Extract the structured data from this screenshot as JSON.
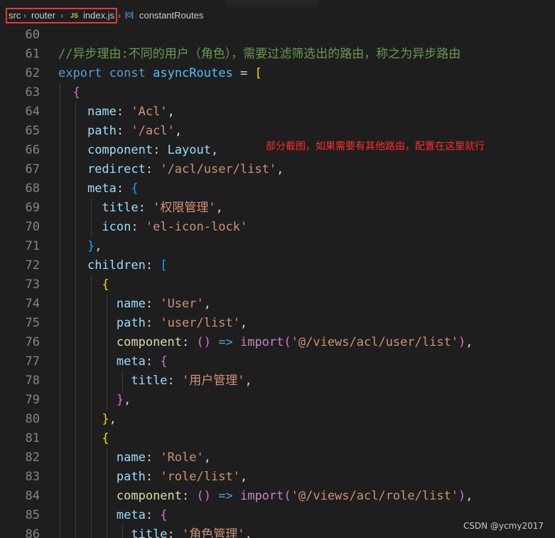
{
  "breadcrumb": {
    "segments": [
      "src",
      "router",
      "index.js",
      "constantRoutes"
    ],
    "file_icon": "JS",
    "symbol_icon": "[⊙]",
    "highlight_color": "#e53935"
  },
  "editor": {
    "line_numbers": [
      "60",
      "61",
      "62",
      "63",
      "64",
      "65",
      "66",
      "67",
      "68",
      "69",
      "70",
      "71",
      "72",
      "73",
      "74",
      "75",
      "76",
      "77",
      "78",
      "79",
      "80",
      "81",
      "82",
      "83",
      "84",
      "85",
      "86"
    ],
    "comment": "//异步理由:不同的用户（角色），需要过滤筛选出的路由，称之为异步路由",
    "export_keyword": "export",
    "const_keyword": "const",
    "routes_var": "asyncRoutes",
    "keys": {
      "name": "name",
      "path": "path",
      "component": "component",
      "redirect": "redirect",
      "meta": "meta",
      "title": "title",
      "icon": "icon",
      "children": "children"
    },
    "values": {
      "acl_name": "'Acl'",
      "acl_path": "'/acl'",
      "acl_component": "Layout",
      "acl_redirect": "'/acl/user/list'",
      "acl_title": "'权限管理'",
      "acl_icon": "'el-icon-lock'",
      "user_name": "'User'",
      "user_path": "'user/list'",
      "user_import_path": "'@/views/acl/user/list'",
      "user_title": "'用户管理'",
      "role_name": "'Role'",
      "role_path": "'role/list'",
      "role_import_path": "'@/views/acl/role/list'",
      "role_title": "'角色管理'"
    },
    "arrow": "=>",
    "import_keyword": "import"
  },
  "annotation": "部分截图，如果需要有其他路由，配置在这里就行",
  "watermark": "CSDN @ycmy2017",
  "colors": {
    "background": "#1e1e1e",
    "annotation": "#ff2d2d",
    "comment": "#6a9955",
    "keyword": "#569cd6",
    "string": "#ce9178",
    "property": "#9cdcfe"
  }
}
